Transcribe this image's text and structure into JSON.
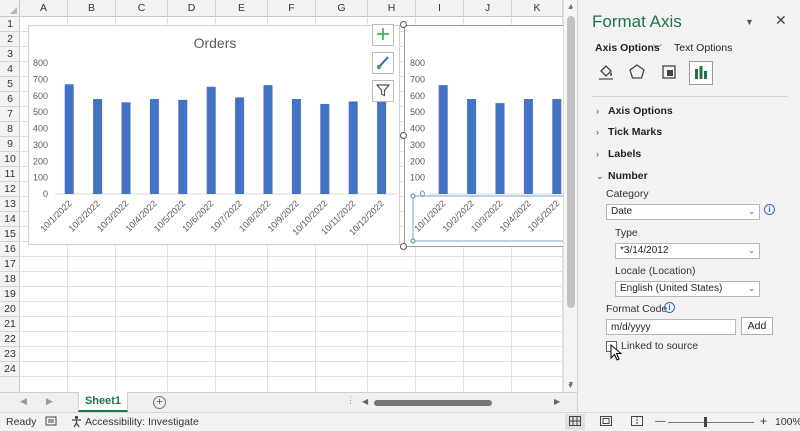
{
  "columns": [
    "A",
    "B",
    "C",
    "D",
    "E",
    "F",
    "G",
    "H",
    "I",
    "J",
    "K"
  ],
  "rows": [
    "1",
    "2",
    "3",
    "4",
    "5",
    "6",
    "7",
    "8",
    "9",
    "10",
    "11",
    "12",
    "13",
    "14",
    "15",
    "16",
    "17",
    "18",
    "19",
    "20",
    "21",
    "22",
    "23",
    "24"
  ],
  "chart1": {
    "title": "Orders",
    "yticks": [
      "800",
      "700",
      "600",
      "500",
      "400",
      "300",
      "200",
      "100",
      "0"
    ],
    "bar_color": "#4472c4"
  },
  "chart2": {
    "yticks": [
      "800",
      "700",
      "600",
      "500",
      "400",
      "300",
      "200",
      "100",
      "0"
    ]
  },
  "chart_data": [
    {
      "type": "bar",
      "title": "Orders",
      "categories": [
        "10/1/2022",
        "10/2/2022",
        "10/3/2022",
        "10/4/2022",
        "10/5/2022",
        "10/6/2022",
        "10/7/2022",
        "10/8/2022",
        "10/9/2022",
        "10/10/2022",
        "10/11/2022",
        "10/12/2022"
      ],
      "values": [
        670,
        580,
        560,
        580,
        575,
        655,
        590,
        665,
        580,
        550,
        565,
        695
      ],
      "ylim": [
        0,
        800
      ],
      "xlabel": "",
      "ylabel": "",
      "grid": false
    },
    {
      "type": "bar",
      "title": "",
      "categories": [
        "10/1/2022",
        "10/2/2022",
        "10/3/2022",
        "10/4/2022",
        "10/5/2022"
      ],
      "values": [
        665,
        580,
        555,
        580,
        580
      ],
      "ylim": [
        0,
        800
      ],
      "xlabel": "",
      "ylabel": "",
      "grid": false
    }
  ],
  "tabs": {
    "sheet": "Sheet1"
  },
  "status": {
    "ready": "Ready",
    "accessibility": "Accessibility: Investigate",
    "zoom": "100%",
    "minus": "—",
    "plus": "+"
  },
  "pane": {
    "title": "Format Axis",
    "tab_axis": "Axis Options",
    "tab_text": "Text Options",
    "sections": [
      "Axis Options",
      "Tick Marks",
      "Labels",
      "Number"
    ],
    "category_label": "Category",
    "category_value": "Date",
    "type_label": "Type",
    "type_value": "*3/14/2012",
    "locale_label": "Locale (Location)",
    "locale_value": "English (United States)",
    "format_code_label": "Format Code",
    "format_code_value": "m/d/yyyy",
    "add_button": "Add",
    "linked_label": "Linked to source",
    "linked_checked": false
  },
  "icons": {
    "add_element": "plus-icon",
    "style": "brush-icon",
    "filter": "funnel-icon",
    "fill": "paint-bucket-icon",
    "effects": "pentagon-icon",
    "size": "size-properties-icon",
    "axis": "bar-chart-icon"
  }
}
